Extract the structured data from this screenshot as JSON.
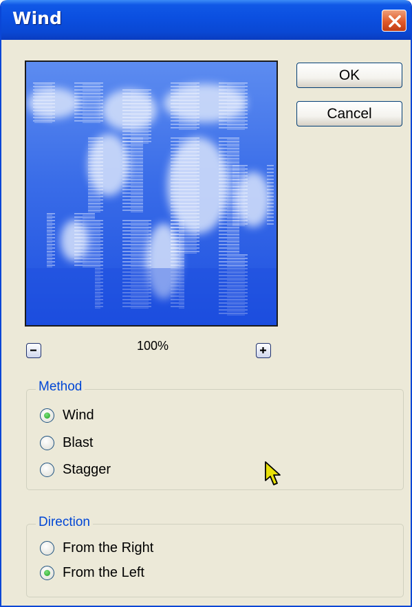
{
  "window": {
    "title": "Wind"
  },
  "buttons": {
    "ok": "OK",
    "cancel": "Cancel"
  },
  "zoom": {
    "level": "100%"
  },
  "method": {
    "legend": "Method",
    "options": [
      {
        "label": "Wind",
        "checked": true
      },
      {
        "label": "Blast",
        "checked": false
      },
      {
        "label": "Stagger",
        "checked": false
      }
    ]
  },
  "direction": {
    "legend": "Direction",
    "options": [
      {
        "label": "From the Right",
        "checked": false
      },
      {
        "label": "From the Left",
        "checked": true
      }
    ]
  },
  "icons": {
    "close": "close-icon",
    "zoom_out": "minus-icon",
    "zoom_in": "plus-icon",
    "cursor": "arrow-cursor-icon"
  },
  "colors": {
    "titlebar": "#0a4fe0",
    "dialog_bg": "#ece9d8",
    "close_button": "#e05a2a",
    "group_label": "#0046d5",
    "preview_blue": "#2f62e6"
  }
}
